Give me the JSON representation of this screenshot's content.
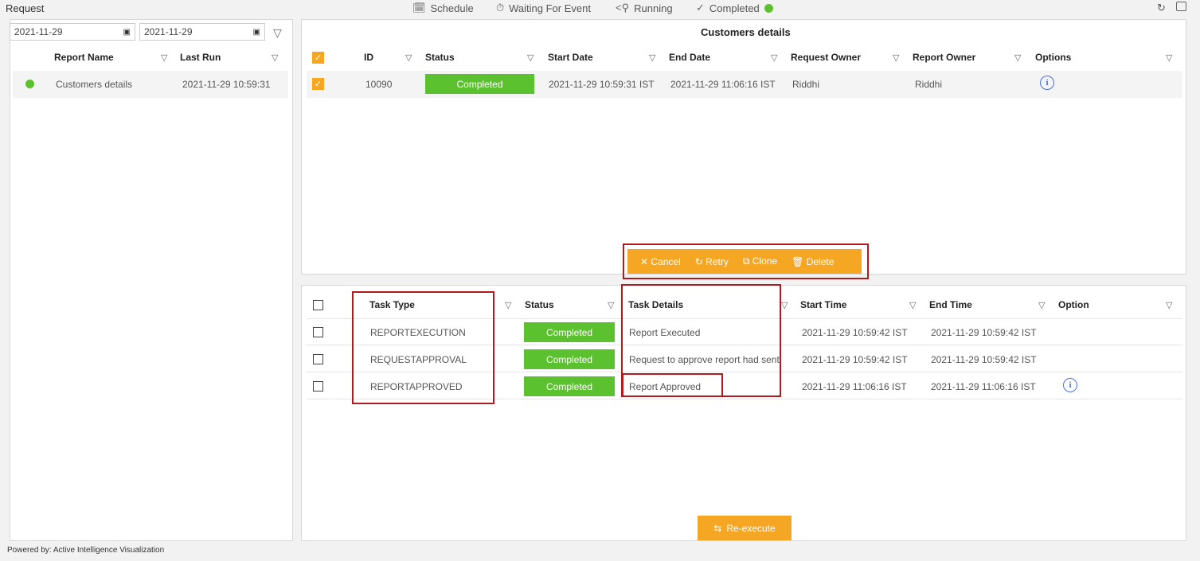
{
  "page": {
    "title": "Request",
    "footer": "Powered by: Active Intelligence Visualization"
  },
  "topnav": [
    {
      "label": "Schedule",
      "icon": "calendar-icon"
    },
    {
      "label": "Waiting For Event",
      "icon": "timer-icon"
    },
    {
      "label": "Running",
      "icon": "running-icon"
    },
    {
      "label": "Completed",
      "icon": "check-icon"
    }
  ],
  "status_color": "#5cc12f",
  "accent_color": "#f5a623",
  "left": {
    "date_from": "2021-11-29",
    "date_to": "2021-11-29",
    "columns": [
      "Report Name",
      "Last Run"
    ],
    "rows": [
      {
        "name": "Customers details",
        "last_run": "2021-11-29 10:59:31"
      }
    ]
  },
  "requests": {
    "title": "Customers details",
    "columns": [
      "ID",
      "Status",
      "Start Date",
      "End Date",
      "Request Owner",
      "Report Owner",
      "Options"
    ],
    "rows": [
      {
        "id": "10090",
        "status": "Completed",
        "start": "2021-11-29 10:59:31 IST",
        "end": "2021-11-29 11:06:16 IST",
        "request_owner": "Riddhi",
        "report_owner": "Riddhi"
      }
    ],
    "actions": {
      "cancel": "Cancel",
      "retry": "Retry",
      "clone": "Clone",
      "delete": "Delete"
    }
  },
  "tasks": {
    "columns": [
      "Task Type",
      "Status",
      "Task Details",
      "Start Time",
      "End Time",
      "Option"
    ],
    "rows": [
      {
        "type": "REPORTEXECUTION",
        "status": "Completed",
        "details": "Report Executed",
        "start": "2021-11-29 10:59:42 IST",
        "end": "2021-11-29 10:59:42 IST"
      },
      {
        "type": "REQUESTAPPROVAL",
        "status": "Completed",
        "details": "Request to approve report had sent",
        "start": "2021-11-29 10:59:42 IST",
        "end": "2021-11-29 10:59:42 IST"
      },
      {
        "type": "REPORTAPPROVED",
        "status": "Completed",
        "details": "Report Approved",
        "start": "2021-11-29 11:06:16 IST",
        "end": "2021-11-29 11:06:16 IST"
      }
    ],
    "reexecute": "Re-execute"
  }
}
